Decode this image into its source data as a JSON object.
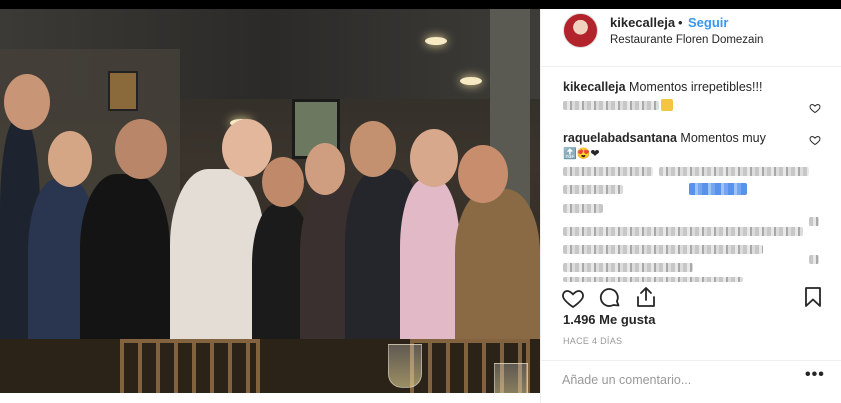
{
  "post": {
    "username": "kikecalleja",
    "dot": "•",
    "follow_label": "Seguir",
    "location": "Restaurante Floren Domezain",
    "caption_user": "kikecalleja",
    "caption_text": "Momentos irrepetibles!!!",
    "comment2_user": "raquelabadsantana",
    "comment2_text": "Momentos muy",
    "comment2_emojis": "🔝😍❤",
    "likes": "1.496 Me gusta",
    "time": "HACE 4 DÍAS",
    "add_comment_placeholder": "Añade un comentario...",
    "more_label": "•••"
  },
  "icons": {
    "like": "heart-icon",
    "comment": "comment-icon",
    "share": "share-icon",
    "save": "bookmark-icon"
  },
  "colors": {
    "link": "#3897f0",
    "text": "#262626",
    "muted": "#999999",
    "border": "#efefef"
  }
}
